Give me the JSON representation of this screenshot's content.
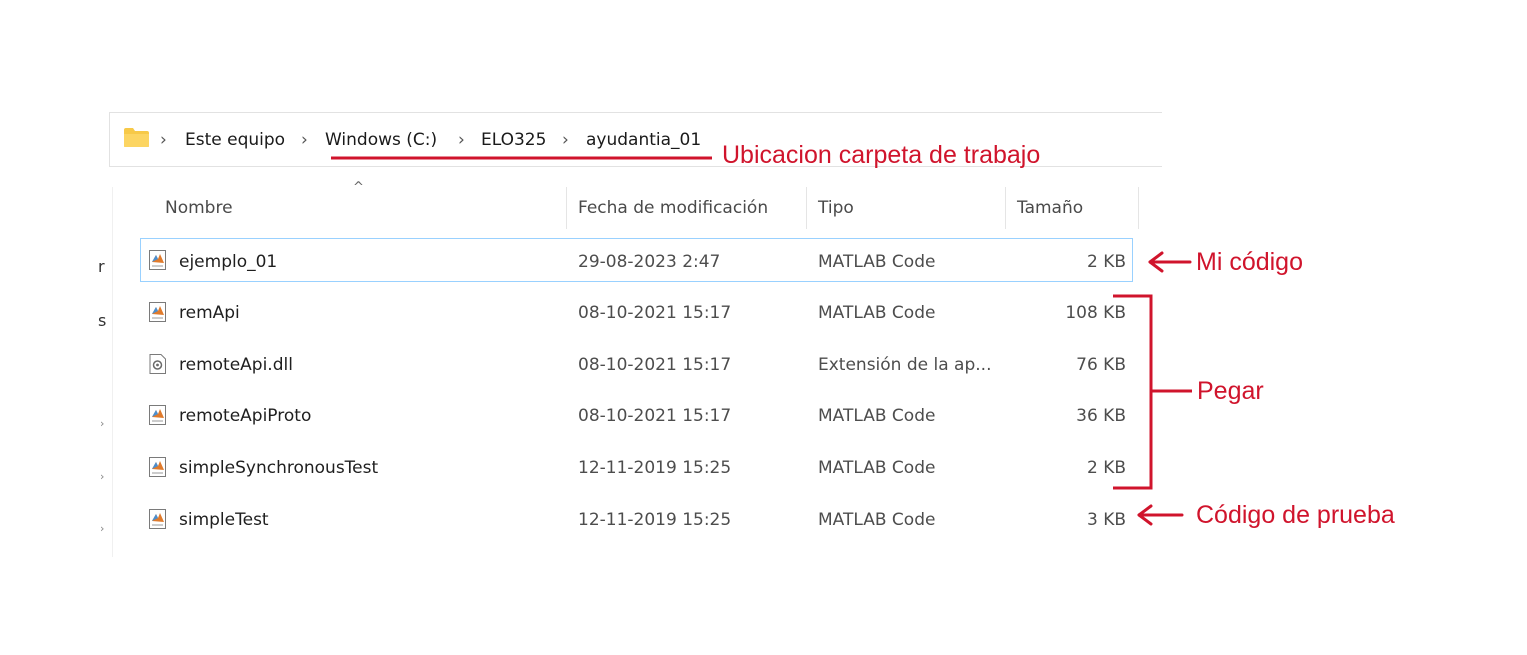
{
  "address_bar": {
    "folder_icon": "folder-icon",
    "separator": "›",
    "crumbs": [
      "Este equipo",
      "Windows (C:)",
      "ELO325",
      "ayudantia_01"
    ]
  },
  "sidebar_fragments": [
    "r",
    "s"
  ],
  "columns": {
    "name": "Nombre",
    "date": "Fecha de modificación",
    "type": "Tipo",
    "size": "Tamaño",
    "sort_indicator": "^"
  },
  "files": [
    {
      "name": "ejemplo_01",
      "date": "29-08-2023 2:47",
      "type": "MATLAB Code",
      "size": "2 KB",
      "icon": "matlab-file-icon",
      "selected": true
    },
    {
      "name": "remApi",
      "date": "08-10-2021 15:17",
      "type": "MATLAB Code",
      "size": "108 KB",
      "icon": "matlab-file-icon"
    },
    {
      "name": "remoteApi.dll",
      "date": "08-10-2021 15:17",
      "type": "Extensión de la ap...",
      "size": "76 KB",
      "icon": "dll-file-icon"
    },
    {
      "name": "remoteApiProto",
      "date": "08-10-2021 15:17",
      "type": "MATLAB Code",
      "size": "36 KB",
      "icon": "matlab-file-icon"
    },
    {
      "name": "simpleSynchronousTest",
      "date": "12-11-2019 15:25",
      "type": "MATLAB Code",
      "size": "2 KB",
      "icon": "matlab-file-icon"
    },
    {
      "name": "simpleTest",
      "date": "12-11-2019 15:25",
      "type": "MATLAB Code",
      "size": "3 KB",
      "icon": "matlab-file-icon"
    }
  ],
  "annotations": {
    "color": "#d0142c",
    "location": "Ubicacion carpeta de trabajo",
    "my_code": "Mi código",
    "paste": "Pegar",
    "test_code": "Código de prueba"
  }
}
